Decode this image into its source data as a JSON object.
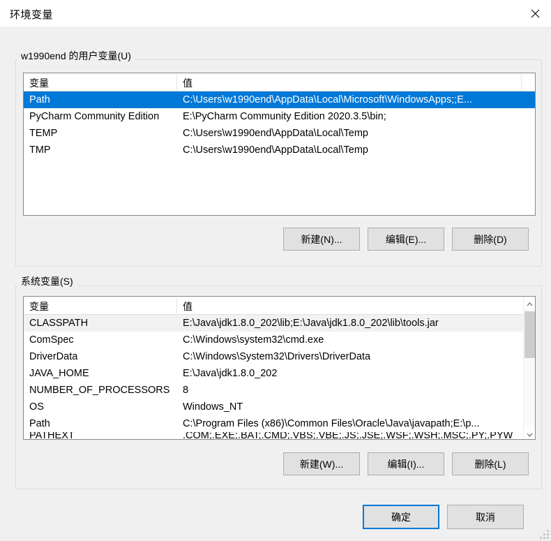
{
  "window": {
    "title": "环境变量",
    "close_icon": "close-icon"
  },
  "user_section": {
    "legend": "w1990end 的用户变量(U)",
    "columns": [
      "变量",
      "值"
    ],
    "rows": [
      {
        "name": "Path",
        "value": "C:\\Users\\w1990end\\AppData\\Local\\Microsoft\\WindowsApps;;E...",
        "selected": true
      },
      {
        "name": "PyCharm Community Edition",
        "value": "E:\\PyCharm Community Edition 2020.3.5\\bin;",
        "selected": false
      },
      {
        "name": "TEMP",
        "value": "C:\\Users\\w1990end\\AppData\\Local\\Temp",
        "selected": false
      },
      {
        "name": "TMP",
        "value": "C:\\Users\\w1990end\\AppData\\Local\\Temp",
        "selected": false
      }
    ],
    "buttons": {
      "new": "新建(N)...",
      "edit": "编辑(E)...",
      "delete": "删除(D)"
    }
  },
  "system_section": {
    "legend": "系统变量(S)",
    "columns": [
      "变量",
      "值"
    ],
    "rows": [
      {
        "name": "CLASSPATH",
        "value": "E:\\Java\\jdk1.8.0_202\\lib;E:\\Java\\jdk1.8.0_202\\lib\\tools.jar",
        "hovered": true
      },
      {
        "name": "ComSpec",
        "value": "C:\\Windows\\system32\\cmd.exe",
        "hovered": false
      },
      {
        "name": "DriverData",
        "value": "C:\\Windows\\System32\\Drivers\\DriverData",
        "hovered": false
      },
      {
        "name": "JAVA_HOME",
        "value": "E:\\Java\\jdk1.8.0_202",
        "hovered": false
      },
      {
        "name": "NUMBER_OF_PROCESSORS",
        "value": "8",
        "hovered": false
      },
      {
        "name": "OS",
        "value": "Windows_NT",
        "hovered": false
      },
      {
        "name": "Path",
        "value": "C:\\Program Files (x86)\\Common Files\\Oracle\\Java\\javapath;E:\\p...",
        "hovered": false
      },
      {
        "name": "PATHEXT",
        "value": ".COM;.EXE;.BAT;.CMD;.VBS;.VBE;.JS;.JSE;.WSF;.WSH;.MSC;.PY;.PYW",
        "hovered": false
      }
    ],
    "buttons": {
      "new": "新建(W)...",
      "edit": "编辑(I)...",
      "delete": "删除(L)"
    },
    "scrollbar": {
      "up_icon": "chevron-up-icon",
      "down_icon": "chevron-down-icon"
    }
  },
  "footer": {
    "ok": "确定",
    "cancel": "取消"
  },
  "colors": {
    "selection_blue": "#0078d7",
    "dialog_background": "#f0f0f0",
    "list_background": "#ffffff",
    "button_face": "#e1e1e1",
    "hover_row": "#f2f2f2"
  }
}
